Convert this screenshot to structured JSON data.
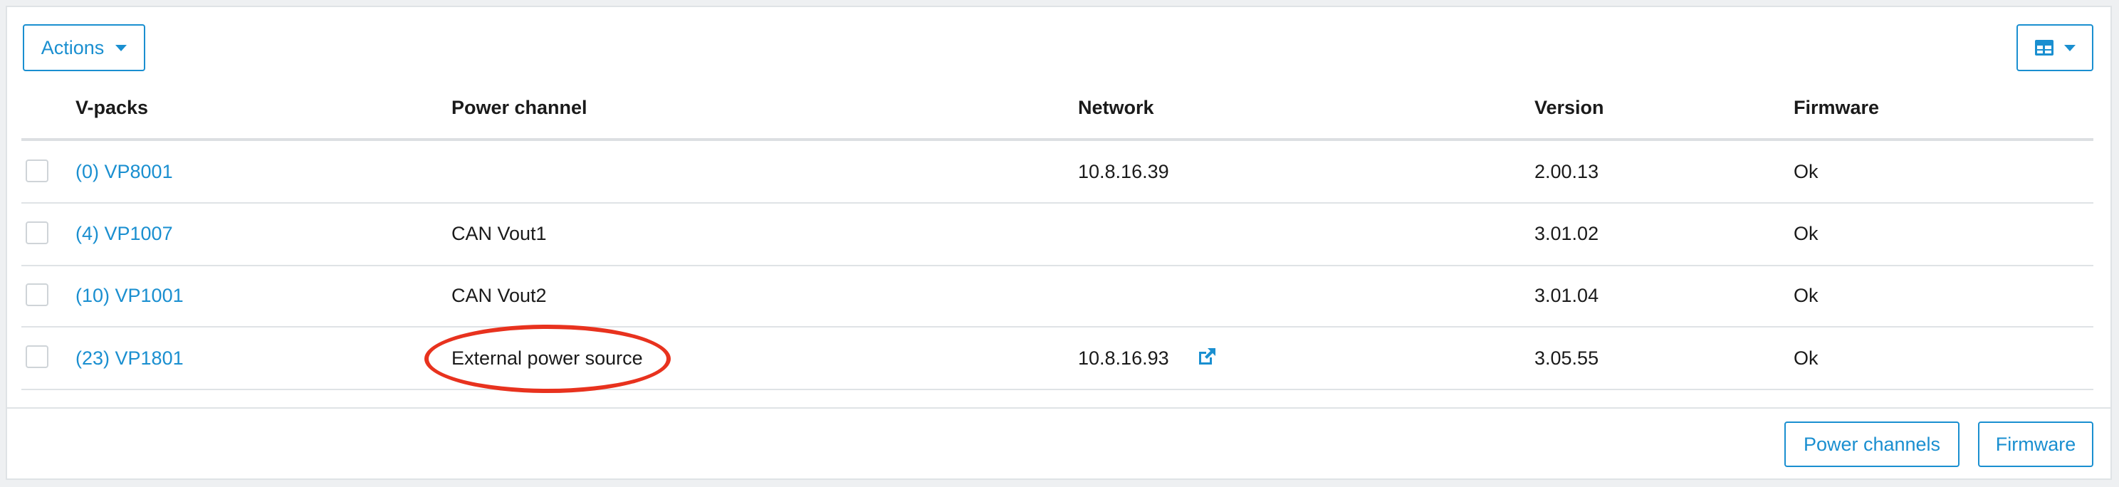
{
  "toolbar": {
    "actions_label": "Actions",
    "columns_icon": "table-columns-icon"
  },
  "table": {
    "columns": [
      "V-packs",
      "Power channel",
      "Network",
      "Version",
      "Firmware"
    ],
    "rows": [
      {
        "vpack": "(0) VP8001",
        "power_channel": "",
        "network": "10.8.16.39",
        "version": "2.00.13",
        "firmware": "Ok",
        "checked": false
      },
      {
        "vpack": "(4) VP1007",
        "power_channel": "CAN Vout1",
        "network": "",
        "version": "3.01.02",
        "firmware": "Ok",
        "checked": false
      },
      {
        "vpack": "(10) VP1001",
        "power_channel": "CAN Vout2",
        "network": "",
        "version": "3.01.04",
        "firmware": "Ok",
        "checked": false
      },
      {
        "vpack": "(23) VP1801",
        "power_channel": "External power source",
        "network": "10.8.16.93",
        "network_icon": "external-link-icon",
        "version": "3.05.55",
        "firmware": "Ok",
        "checked": false
      }
    ]
  },
  "footer": {
    "power_channels_label": "Power channels",
    "firmware_label": "Firmware"
  },
  "colors": {
    "accent": "#1a8fd0",
    "highlight_circle": "#e8321e"
  }
}
